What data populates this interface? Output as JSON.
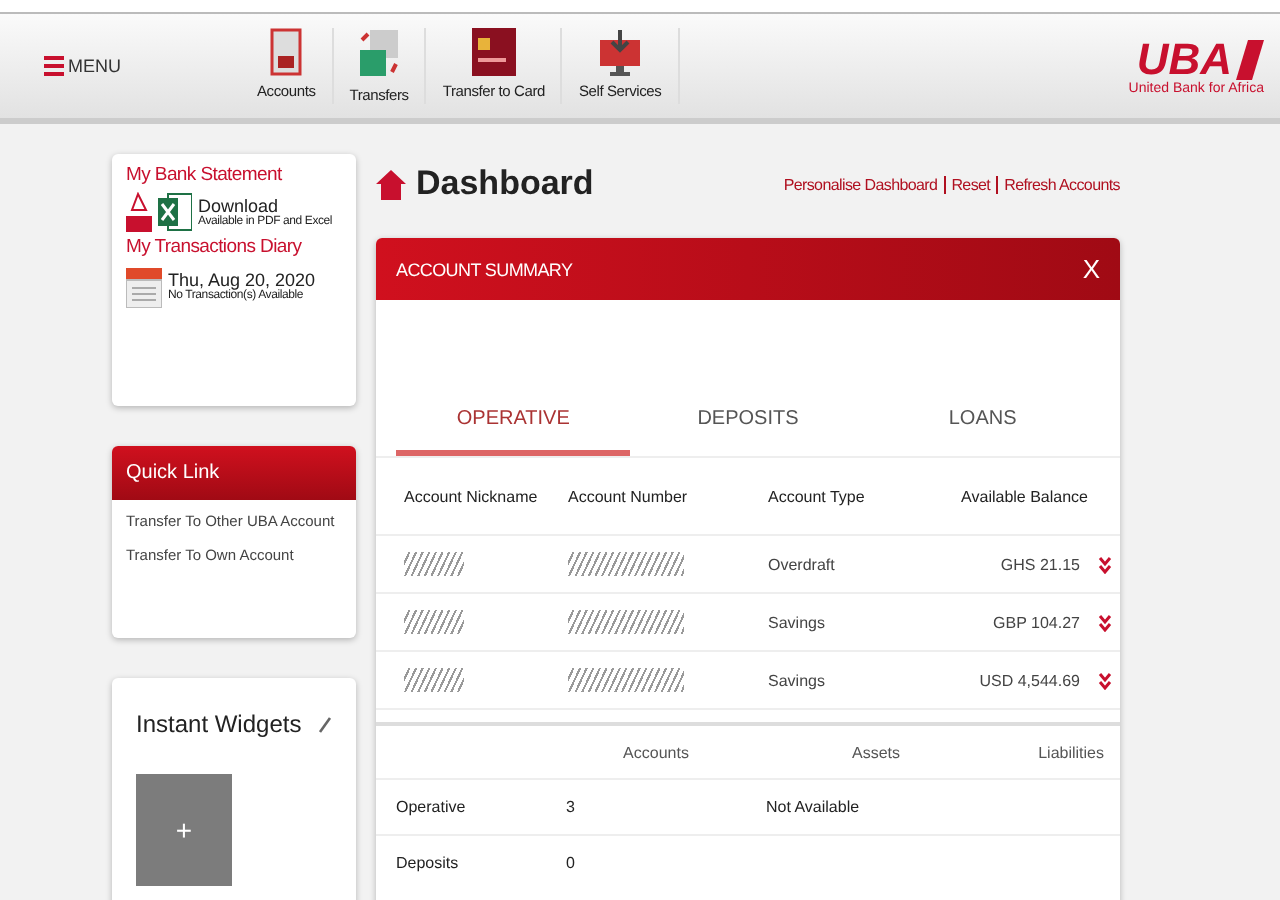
{
  "header": {
    "menu_label": "MENU",
    "nav": [
      {
        "kind": "accounts",
        "label": "Accounts"
      },
      {
        "kind": "transfers",
        "label": "Transfers"
      },
      {
        "kind": "card",
        "label": "Transfer to Card"
      },
      {
        "kind": "self",
        "label": "Self Services"
      }
    ],
    "logo": {
      "wordmark": "UBA",
      "tagline": "United Bank for Africa"
    }
  },
  "sidebar": {
    "statement": {
      "title": "My Bank Statement",
      "download": "Download",
      "download_note": "Available in PDF and Excel",
      "diary_title": "My Transactions Diary",
      "date": "Thu, Aug 20, 2020",
      "diary_note": "No Transaction(s) Available"
    },
    "quick_link": {
      "title": "Quick Link",
      "links": [
        "Transfer To Other UBA Account",
        "Transfer To Own Account"
      ]
    },
    "widgets": {
      "title": "Instant Widgets",
      "add": "+"
    }
  },
  "main": {
    "title": "Dashboard",
    "actions": [
      "Personalise Dashboard",
      "Reset",
      "Refresh Accounts"
    ],
    "summary": {
      "title": "ACCOUNT SUMMARY",
      "close": "X",
      "tabs": [
        {
          "label": "OPERATIVE",
          "selected": true
        },
        {
          "label": "DEPOSITS",
          "selected": false
        },
        {
          "label": "LOANS",
          "selected": false
        }
      ],
      "columns": [
        "Account Nickname",
        "Account Number",
        "Account Type",
        "Available Balance"
      ],
      "rows": [
        {
          "type": "Overdraft",
          "balance": "GHS 21.15"
        },
        {
          "type": "Savings",
          "balance": "GBP 104.27"
        },
        {
          "type": "Savings",
          "balance": "USD 4,544.69"
        }
      ],
      "totals": {
        "columns": [
          "Accounts",
          "Assets",
          "Liabilities"
        ],
        "rows": [
          {
            "label": "Operative",
            "accounts": "3",
            "assets": "Not Available"
          },
          {
            "label": "Deposits",
            "accounts": "0"
          }
        ]
      }
    }
  }
}
